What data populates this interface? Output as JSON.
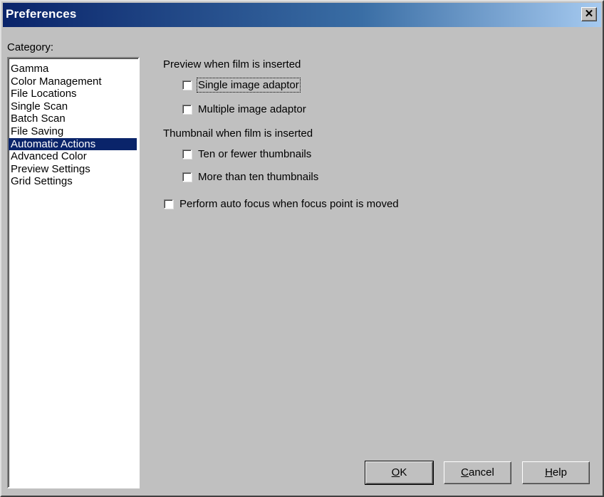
{
  "window": {
    "title": "Preferences",
    "close_glyph": "✕"
  },
  "category": {
    "label": "Category:",
    "items": [
      "Gamma",
      "Color Management",
      "File Locations",
      "Single Scan",
      "Batch Scan",
      "File Saving",
      "Automatic Actions",
      "Advanced Color",
      "Preview Settings",
      "Grid Settings"
    ],
    "selected": "Automatic Actions"
  },
  "preview": {
    "heading": "Preview when film is inserted",
    "single": {
      "label": "Single image adaptor",
      "checked": false
    },
    "multiple": {
      "label": "Multiple image adaptor",
      "checked": false
    }
  },
  "thumbnail": {
    "heading": "Thumbnail when film is inserted",
    "fewer": {
      "label": "Ten or fewer thumbnails",
      "checked": false
    },
    "more": {
      "label": "More than ten thumbnails",
      "checked": false
    }
  },
  "autofocus": {
    "label": "Perform auto focus when focus point is moved",
    "checked": false
  },
  "buttons": {
    "ok": {
      "mnemonic": "O",
      "rest": "K"
    },
    "cancel": {
      "mnemonic": "C",
      "rest": "ancel"
    },
    "help": {
      "mnemonic": "H",
      "rest": "elp"
    }
  }
}
